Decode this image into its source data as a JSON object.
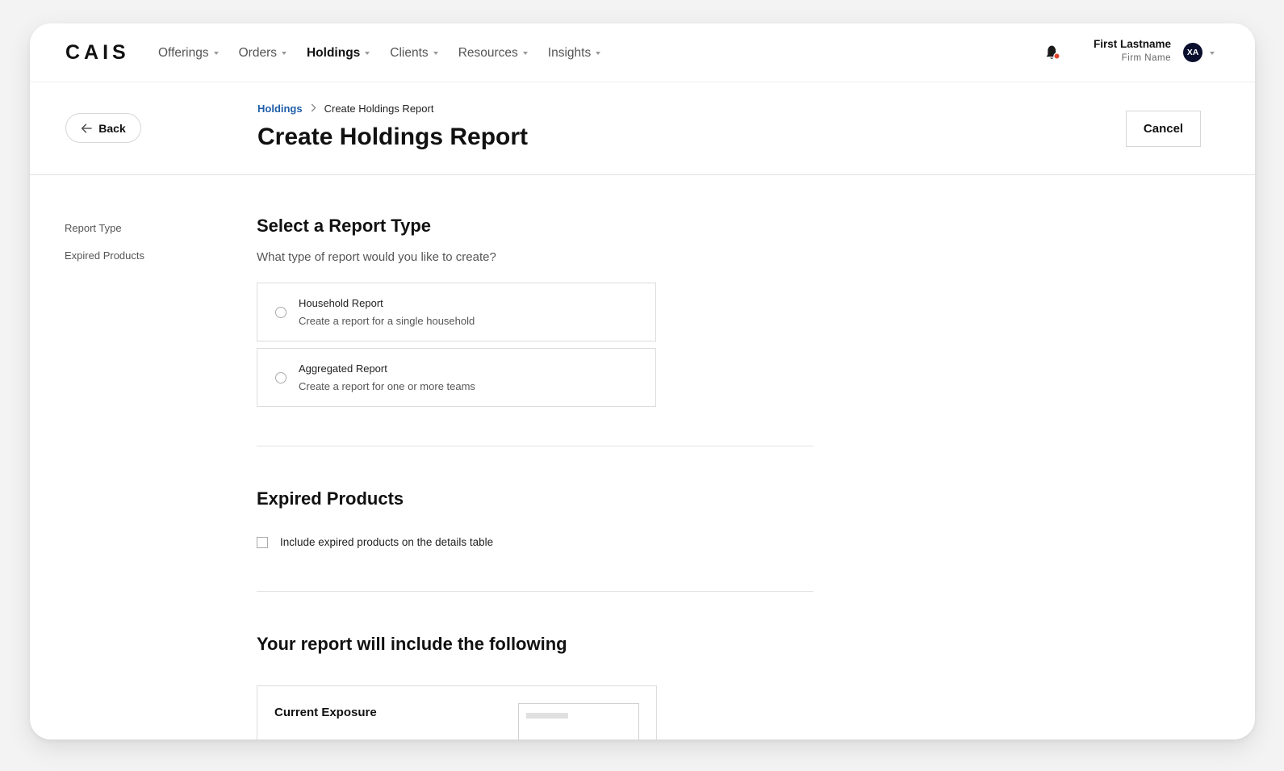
{
  "nav": {
    "logo": "CAIS",
    "items": [
      {
        "label": "Offerings"
      },
      {
        "label": "Orders"
      },
      {
        "label": "Holdings"
      },
      {
        "label": "Clients"
      },
      {
        "label": "Resources"
      },
      {
        "label": "Insights"
      }
    ],
    "active_item": "Holdings",
    "notification_icon": "bell-icon",
    "notification_dot_color": "#e0442c",
    "user": {
      "name": "First Lastname",
      "firm": "Firm Name",
      "initials": "XA"
    }
  },
  "header": {
    "back_label": "Back",
    "breadcrumb": {
      "parent": "Holdings",
      "current": "Create Holdings Report"
    },
    "title": "Create Holdings Report",
    "cancel_label": "Cancel"
  },
  "sidenav": {
    "items": [
      "Report Type",
      "Expired Products"
    ]
  },
  "report_type": {
    "title": "Select a Report Type",
    "question": "What type of report would you like to create?",
    "options": [
      {
        "title": "Household Report",
        "description": "Create a report for a single household"
      },
      {
        "title": "Aggregated Report",
        "description": "Create a report for one or more teams"
      }
    ]
  },
  "expired_products": {
    "title": "Expired Products",
    "checkbox_label": "Include expired products on the details table"
  },
  "summary": {
    "title": "Your report will include the following",
    "card_title": "Current Exposure"
  },
  "colors": {
    "accent_link": "#1f5ea8",
    "avatar_bg": "#0b0f2e"
  }
}
